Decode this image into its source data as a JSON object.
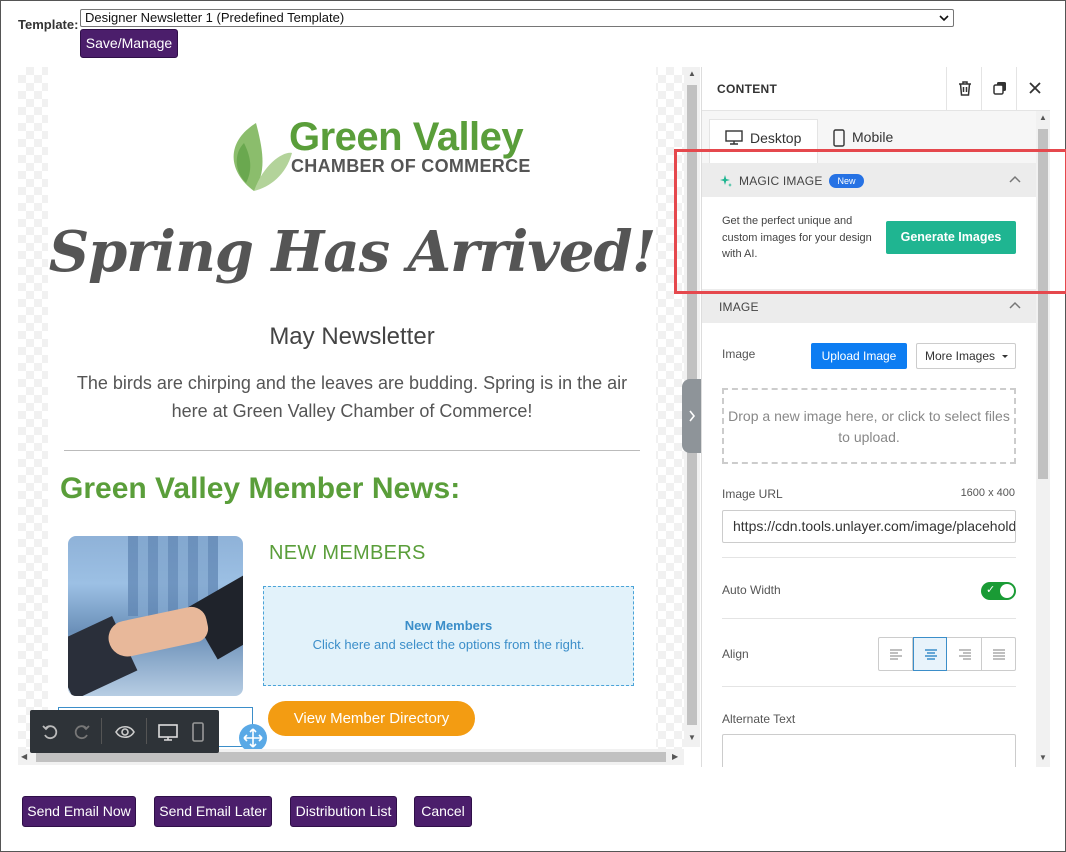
{
  "template": {
    "label": "Template:",
    "selected": "Designer Newsletter 1 (Predefined Template)",
    "save_button": "Save/Manage"
  },
  "email": {
    "logo_line1": "Green Valley",
    "logo_line2": "CHAMBER OF COMMERCE",
    "headline": "Spring Has Arrived!",
    "subhead": "May Newsletter",
    "intro": "The birds are chirping and the leaves are budding. Spring is in the air here at Green Valley Chamber of Commerce!",
    "member_news_title": "Green Valley Member News:",
    "new_members_heading": "NEW MEMBERS",
    "placeholder_title": "New Members",
    "placeholder_text": "Click here and select the options from the right.",
    "directory_button": "View Member Directory"
  },
  "panel": {
    "title": "CONTENT",
    "tabs": [
      {
        "label": "Desktop",
        "active": true
      },
      {
        "label": "Mobile",
        "active": false
      }
    ],
    "magic_image": {
      "header": "MAGIC IMAGE",
      "badge": "New",
      "description": "Get the perfect unique and custom images for your design with AI.",
      "button": "Generate Images"
    },
    "image": {
      "header": "IMAGE",
      "label": "Image",
      "upload_button": "Upload Image",
      "more_button": "More Images",
      "drop_text": "Drop a new image here, or click to select files to upload.",
      "url_label": "Image URL",
      "dimensions": "1600 x 400",
      "url_value": "https://cdn.tools.unlayer.com/image/placeholder.png",
      "auto_width_label": "Auto Width",
      "auto_width": true,
      "align_label": "Align",
      "align_selected": "center",
      "alt_label": "Alternate Text"
    }
  },
  "actions": {
    "send_now": "Send Email Now",
    "send_later": "Send Email Later",
    "distribution": "Distribution List",
    "cancel": "Cancel"
  },
  "colors": {
    "brand_purple": "#4b1e6b",
    "brand_green": "#5a9e3a",
    "generate_green": "#1fb591",
    "upload_blue": "#0d7df2",
    "directory_orange": "#f39c12",
    "highlight_red": "#e5484d"
  }
}
